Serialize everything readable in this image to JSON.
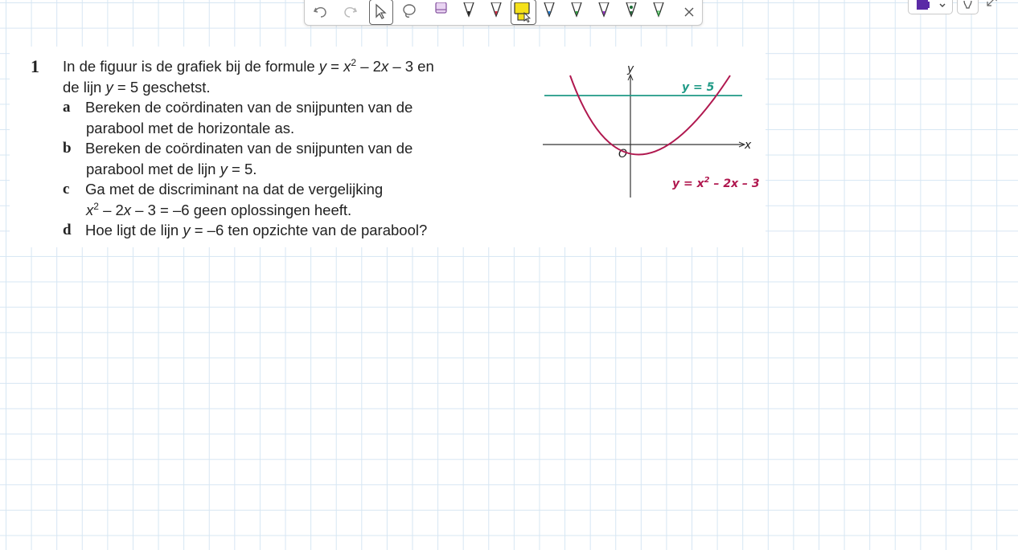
{
  "toolbar": {
    "tools": [
      "undo-icon",
      "redo-icon",
      "select-icon",
      "lasso-icon",
      "eraser-icon",
      "pen-black-icon",
      "pen-red-icon",
      "highlighter-yellow-icon",
      "pen-blue-icon",
      "pen-green-icon",
      "pen-purple-icon",
      "pen-dark-green-icon",
      "pen-outline-green-icon",
      "close-icon"
    ],
    "active_tool": "highlighter-yellow-icon",
    "colors": {
      "black": "#1a1a1a",
      "red": "#e0223f",
      "yellow": "#f5e11a",
      "blue": "#1f7fd9",
      "green": "#2aa83c",
      "purple": "#9b2fd0",
      "dark_green": "#1c6b35",
      "picker": "#5b2aa6"
    }
  },
  "exercise": {
    "number": "1",
    "intro_line1_a": "In de figuur is de grafiek bij de formule ",
    "intro_y": "y",
    "intro_eq": " = ",
    "intro_x": "x",
    "intro_sup": "2",
    "intro_line1_b": " – 2",
    "intro_x2": "x",
    "intro_line1_c": " – 3 en",
    "intro_line2_a": "de lijn ",
    "intro_line2_y": "y",
    "intro_line2_b": " = 5 geschetst.",
    "a_label": "a",
    "a_line1": "Bereken de coördinaten van de snijpunten van de",
    "a_line2": "parabool met de horizontale as.",
    "b_label": "b",
    "b_line1": "Bereken de coördinaten van de snijpunten van de",
    "b_line2_a": "parabool met de lijn ",
    "b_line2_y": "y",
    "b_line2_b": " = 5.",
    "c_label": "c",
    "c_line1": "Ga met de discriminant na dat de vergelijking",
    "c_line2_x": "x",
    "c_line2_sup": "2",
    "c_line2_b": " – 2",
    "c_line2_x2": "x",
    "c_line2_c": " – 3 = –6 geen oplossingen heeft.",
    "d_label": "d",
    "d_line_a": "Hoe ligt de lijn ",
    "d_line_y": "y",
    "d_line_b": " = –6 ten opzichte van de parabool?"
  },
  "graph": {
    "y_axis_label": "y",
    "x_axis_label": "x",
    "origin_label": "O",
    "line_label": "y = 5",
    "parabola_label_a": "y = x",
    "parabola_label_sup": "2",
    "parabola_label_b": " – 2x – 3",
    "line_color": "#1f9a86",
    "parabola_color": "#b0184f"
  }
}
